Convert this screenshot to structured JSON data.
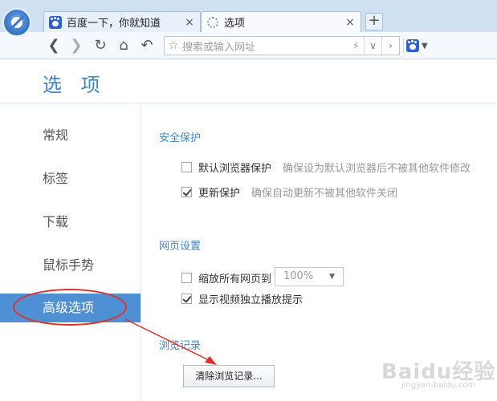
{
  "tabs": [
    {
      "label": "百度一下，你就知道",
      "close": "×"
    },
    {
      "label": "选项",
      "close": "×"
    }
  ],
  "new_tab": "+",
  "address_bar": {
    "placeholder": "搜索或输入网址"
  },
  "page_title": "选 项",
  "sidebar": {
    "items": [
      {
        "label": "常规"
      },
      {
        "label": "标签"
      },
      {
        "label": "下载"
      },
      {
        "label": "鼠标手势"
      },
      {
        "label": "高级选项"
      }
    ],
    "active_index": 4
  },
  "sections": {
    "security": {
      "title": "安全保护",
      "options": [
        {
          "label": "默认浏览器保护",
          "desc": "确保设为默认浏览器后不被其他软件修改",
          "checked": false
        },
        {
          "label": "更新保护",
          "desc": "确保自动更新不被其他软件关闭",
          "checked": true
        }
      ]
    },
    "webpage": {
      "title": "网页设置",
      "options": [
        {
          "label": "缩放所有网页到",
          "checked": false
        },
        {
          "label": "显示视频独立播放提示",
          "checked": true
        }
      ],
      "zoom_value": "100%"
    },
    "history": {
      "title": "浏览记录",
      "clear_button": "清除浏览记录..."
    }
  },
  "watermark": {
    "text": "Baidu经验",
    "sub": "jingyan.baidu.com"
  },
  "colors": {
    "accent": "#3e86c8",
    "active_item": "#4f8fd4",
    "annotation": "#e0302a"
  }
}
